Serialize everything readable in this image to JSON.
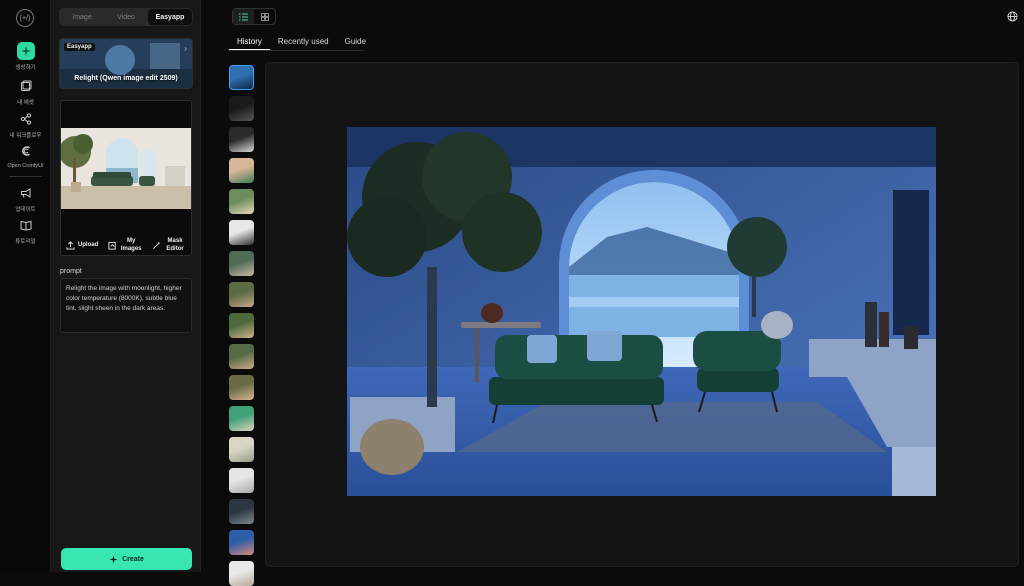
{
  "nav": {
    "logo": "(+/)",
    "items": [
      {
        "label": "생성하기",
        "icon": "sparkle-icon"
      },
      {
        "label": "내 에셋",
        "icon": "gallery-icon"
      },
      {
        "label": "내 워크플로우",
        "icon": "workflow-icon"
      },
      {
        "label": "Open ComfyUI",
        "icon": "comfyui-icon"
      },
      {
        "label": "업데이트",
        "icon": "megaphone-icon"
      },
      {
        "label": "튜토리얼",
        "icon": "book-icon"
      }
    ]
  },
  "panel": {
    "tabs": [
      "Image",
      "Video",
      "Easyapp"
    ],
    "active_tab": "Easyapp",
    "app_card": {
      "badge": "Easyapp",
      "name": "Relight (Qwen image edit 2509)"
    },
    "tools": {
      "upload": "Upload",
      "my_images": "My Images",
      "mask_editor": "Mask Editor"
    },
    "prompt_label": "prompt",
    "prompt_text": "Relight the image with moonlight, higher color temperature (8000K), subtle blue tint, slight sheen in the dark areas.",
    "create_label": "Create"
  },
  "view_toggle": {
    "list_icon": "list-icon",
    "grid_icon": "grid-icon",
    "active": "list"
  },
  "history_tabs": [
    "History",
    "Recently used",
    "Guide"
  ],
  "active_history_tab": "History",
  "thumbnails": [
    {
      "desc": "interior-blue",
      "c1": "#2f6fb0",
      "c2": "#0f2744"
    },
    {
      "desc": "portrait-dark",
      "c1": "#1a1a1a",
      "c2": "#555555"
    },
    {
      "desc": "portrait-hat",
      "c1": "#2b2b2b",
      "c2": "#d9d9d9"
    },
    {
      "desc": "portrait-green",
      "c1": "#d7b79a",
      "c2": "#3e7b54"
    },
    {
      "desc": "portrait-outdoor",
      "c1": "#6d8d5a",
      "c2": "#e8d8c0"
    },
    {
      "desc": "portrait-suit",
      "c1": "#e7e7e7",
      "c2": "#333333"
    },
    {
      "desc": "portrait-green-bg",
      "c1": "#4f6b55",
      "c2": "#c9b7a6"
    },
    {
      "desc": "portrait-olive",
      "c1": "#5c6b43",
      "c2": "#c8a88c"
    },
    {
      "desc": "portrait-olive-2",
      "c1": "#4d6a3c",
      "c2": "#d0b090"
    },
    {
      "desc": "portrait-olive-3",
      "c1": "#556b45",
      "c2": "#c9a98a"
    },
    {
      "desc": "portrait-olive-4",
      "c1": "#6a6b45",
      "c2": "#d6b493"
    },
    {
      "desc": "portrait-mint",
      "c1": "#3fa279",
      "c2": "#e3d2c0"
    },
    {
      "desc": "sketch-light",
      "c1": "#d9d6c6",
      "c2": "#9b9a88"
    },
    {
      "desc": "sketch-white",
      "c1": "#e5e5e5",
      "c2": "#a8a8a8"
    },
    {
      "desc": "portrait-dark-2",
      "c1": "#2c3540",
      "c2": "#7a8a8e"
    },
    {
      "desc": "portrait-blue",
      "c1": "#2f5ea8",
      "c2": "#d88a7a"
    },
    {
      "desc": "portrait-light",
      "c1": "#e9e9e9",
      "c2": "#b6a89a"
    }
  ],
  "colors": {
    "accent": "#39e6b1",
    "panel_bg": "#171717",
    "selected_border": "#3aa0ff"
  }
}
